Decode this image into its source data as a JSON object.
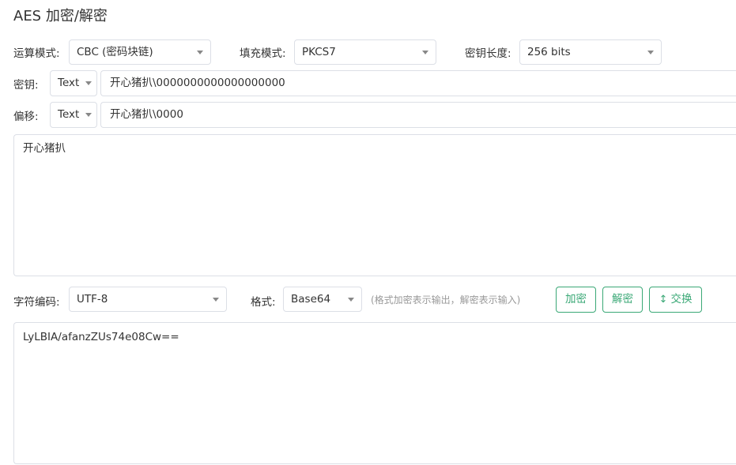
{
  "page": {
    "title": "AES 加密/解密"
  },
  "options": {
    "mode_label": "运算模式:",
    "mode_value": "CBC (密码块链)",
    "padding_label": "填充模式:",
    "padding_value": "PKCS7",
    "keylen_label": "密钥长度:",
    "keylen_value": "256 bits"
  },
  "key": {
    "label": "密钥:",
    "format": "Text",
    "value": "开心猪扒\\0000000000000000000"
  },
  "iv": {
    "label": "偏移:",
    "format": "Text",
    "value": "开心猪扒\\0000"
  },
  "input": {
    "value": "开心猪扒"
  },
  "encoding": {
    "charset_label": "字符编码:",
    "charset_value": "UTF-8",
    "format_label": "格式:",
    "format_value": "Base64",
    "hint": "(格式加密表示输出，解密表示输入)"
  },
  "actions": {
    "encrypt": "加密",
    "decrypt": "解密",
    "swap": "交换",
    "swap_icon": "↕"
  },
  "output": {
    "value": "LyLBIA/afanzZUs74e08Cw=="
  }
}
